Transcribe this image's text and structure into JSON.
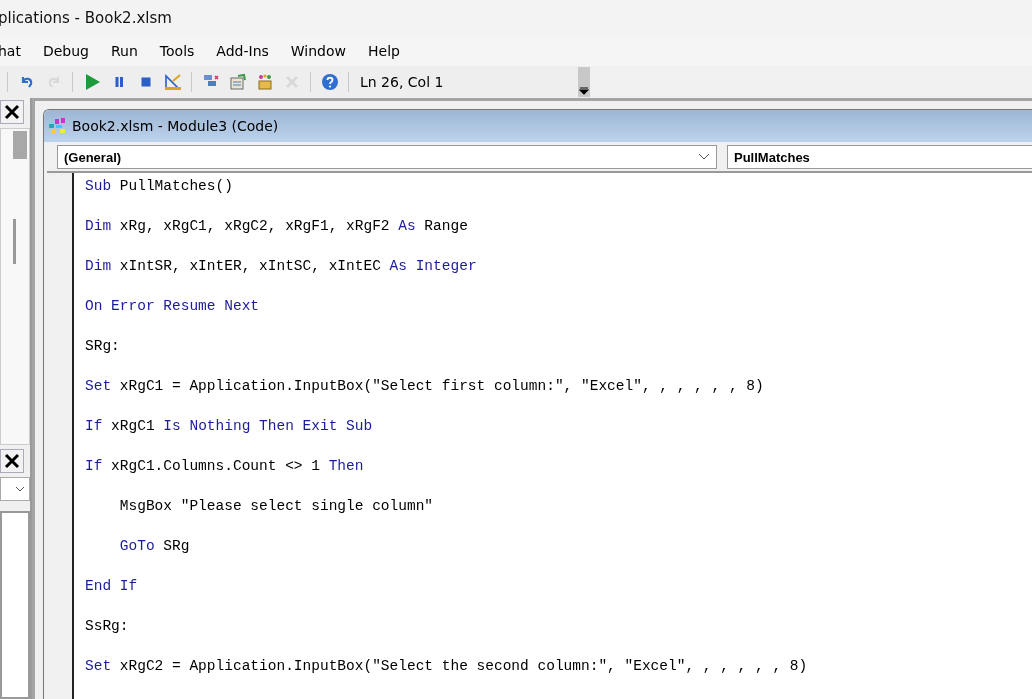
{
  "window": {
    "title": "plications - Book2.xlsm"
  },
  "menu": [
    {
      "label": "hat"
    },
    {
      "label": "Debug"
    },
    {
      "label": "Run"
    },
    {
      "label": "Tools"
    },
    {
      "label": "Add-Ins"
    },
    {
      "label": "Window"
    },
    {
      "label": "Help"
    }
  ],
  "toolbar": {
    "groups": [
      [
        {
          "kind": "undo",
          "disabled": false
        },
        {
          "kind": "redo",
          "disabled": true
        }
      ],
      [
        {
          "kind": "run",
          "disabled": false
        },
        {
          "kind": "pause",
          "disabled": false
        },
        {
          "kind": "stop",
          "disabled": false
        },
        {
          "kind": "design",
          "disabled": false
        }
      ],
      [
        {
          "kind": "project",
          "disabled": false
        },
        {
          "kind": "properties",
          "disabled": false
        },
        {
          "kind": "browser",
          "disabled": false
        },
        {
          "kind": "toolbox",
          "disabled": true
        }
      ],
      [
        {
          "kind": "help",
          "disabled": false
        }
      ]
    ],
    "position": "Ln 26, Col 1"
  },
  "code_window": {
    "title": "Book2.xlsm - Module3 (Code)",
    "object_dropdown": "(General)",
    "procedure_dropdown": "PullMatches",
    "lines": [
      [
        {
          "text": "Sub",
          "kind": "keyword"
        },
        {
          "text": " PullMatches()",
          "kind": "plain"
        }
      ],
      [
        {
          "text": "Dim",
          "kind": "keyword"
        },
        {
          "text": " xRg, xRgC1, xRgC2, xRgF1, xRgF2 ",
          "kind": "plain"
        },
        {
          "text": "As",
          "kind": "keyword"
        },
        {
          "text": " Range",
          "kind": "plain"
        }
      ],
      [
        {
          "text": "Dim",
          "kind": "keyword"
        },
        {
          "text": " xIntSR, xIntER, xIntSC, xIntEC ",
          "kind": "plain"
        },
        {
          "text": "As Integer",
          "kind": "keyword"
        }
      ],
      [
        {
          "text": "On Error Resume Next",
          "kind": "keyword"
        }
      ],
      [
        {
          "text": "SRg:",
          "kind": "plain"
        }
      ],
      [
        {
          "text": "Set",
          "kind": "keyword"
        },
        {
          "text": " xRgC1 = Application.InputBox(\"Select first column:\", \"Excel\", , , , , , 8)",
          "kind": "plain"
        }
      ],
      [
        {
          "text": "If",
          "kind": "keyword"
        },
        {
          "text": " xRgC1 ",
          "kind": "plain"
        },
        {
          "text": "Is Nothing Then Exit Sub",
          "kind": "keyword"
        }
      ],
      [
        {
          "text": "If",
          "kind": "keyword"
        },
        {
          "text": " xRgC1.Columns.Count <> 1 ",
          "kind": "plain"
        },
        {
          "text": "Then",
          "kind": "keyword"
        }
      ],
      [
        {
          "text": "    MsgBox \"Please select single column\"",
          "kind": "plain"
        }
      ],
      [
        {
          "text": "    GoTo",
          "kind": "keyword"
        },
        {
          "text": " SRg",
          "kind": "plain"
        }
      ],
      [
        {
          "text": "End If",
          "kind": "keyword"
        }
      ],
      [
        {
          "text": "SsRg:",
          "kind": "plain"
        }
      ],
      [
        {
          "text": "Set",
          "kind": "keyword"
        },
        {
          "text": " xRgC2 = Application.InputBox(\"Select the second column:\", \"Excel\", , , , , , 8)",
          "kind": "plain"
        }
      ]
    ]
  }
}
